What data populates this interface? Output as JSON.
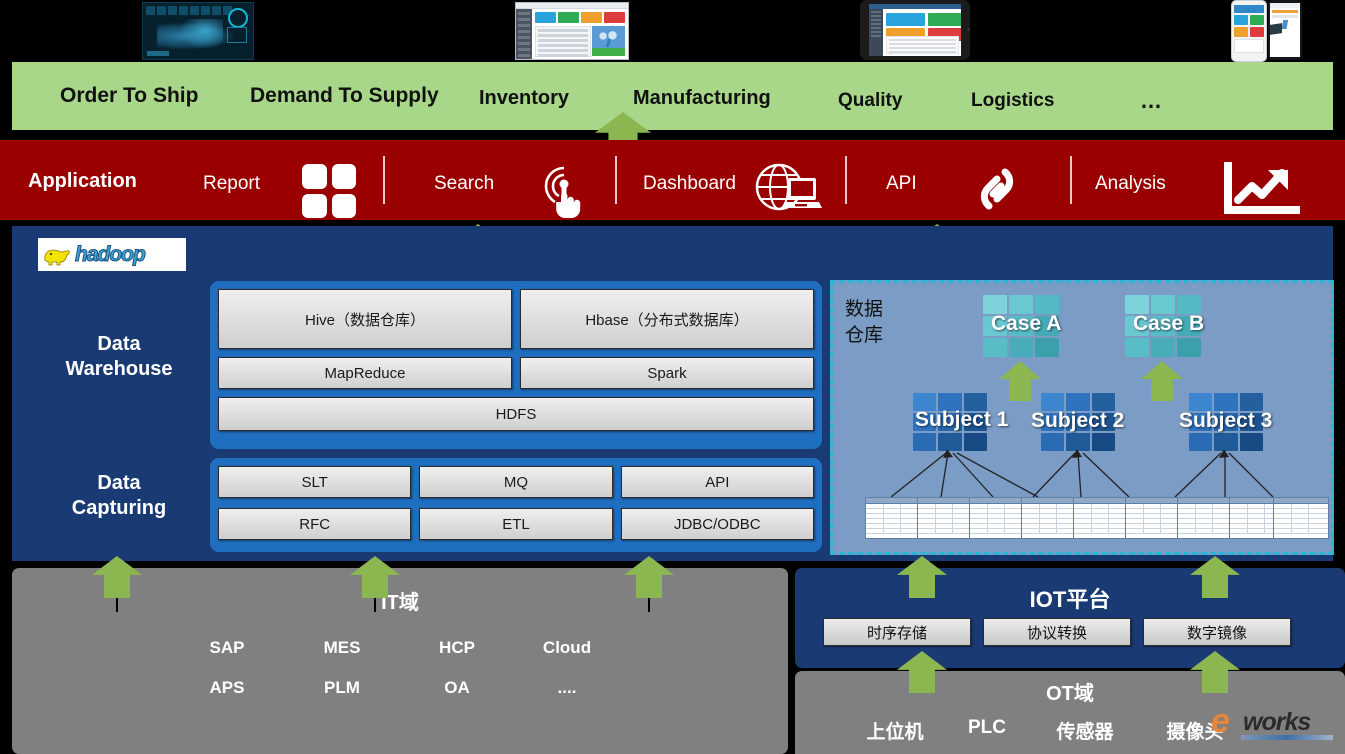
{
  "top_devices": [
    {
      "name": "dark-dashboard-screenshot"
    },
    {
      "name": "web-dashboard-screenshot"
    },
    {
      "name": "tablet-dashboard-screenshot"
    },
    {
      "name": "phone-dashboard-screenshot"
    },
    {
      "name": "phone-chart-screenshot"
    }
  ],
  "business_domains": {
    "items": [
      {
        "label": "Order To Ship"
      },
      {
        "label": "Demand To Supply"
      },
      {
        "label": "Inventory"
      },
      {
        "label": "Manufacturing"
      },
      {
        "label": "Quality"
      },
      {
        "label": "Logistics"
      },
      {
        "label": "…"
      }
    ],
    "color": "#a8d78a"
  },
  "application_layer": {
    "title": "Application",
    "color": "#9a0000",
    "items": [
      {
        "label": "Report",
        "icon": "grid-squares-icon"
      },
      {
        "label": "Search",
        "icon": "touch-tap-icon"
      },
      {
        "label": "Dashboard",
        "icon": "globe-laptop-icon"
      },
      {
        "label": "API",
        "icon": "chain-link-icon"
      },
      {
        "label": "Analysis",
        "icon": "trend-chart-icon"
      }
    ]
  },
  "platform": {
    "logo": "hadoop",
    "logo_text": "hadoop",
    "color": "#1a3a74",
    "warehouse": {
      "label_line1": "Data",
      "label_line2": "Warehouse",
      "row1": [
        {
          "label": "Hive（数据仓库）"
        },
        {
          "label": "Hbase（分布式数据库）"
        }
      ],
      "row2": [
        {
          "label": "MapReduce"
        },
        {
          "label": "Spark"
        }
      ],
      "row3": [
        {
          "label": "HDFS"
        }
      ]
    },
    "capturing": {
      "label_line1": "Data",
      "label_line2": "Capturing",
      "row1": [
        {
          "label": "SLT"
        },
        {
          "label": "MQ"
        },
        {
          "label": "API"
        }
      ],
      "row2": [
        {
          "label": "RFC"
        },
        {
          "label": "ETL"
        },
        {
          "label": "JDBC/ODBC"
        }
      ]
    }
  },
  "data_warehouse_panel": {
    "caption_line1": "数据",
    "caption_line2": "仓库",
    "background": "#7b9cc4",
    "border_color": "#2bb6d8",
    "cases": [
      {
        "label": "Case A",
        "color": "#5bc5cf"
      },
      {
        "label": "Case B",
        "color": "#5bc5cf"
      }
    ],
    "subjects": [
      {
        "label": "Subject 1",
        "color": "#1a5fa8"
      },
      {
        "label": "Subject 2",
        "color": "#1a5fa8"
      },
      {
        "label": "Subject 3",
        "color": "#1a5fa8"
      }
    ],
    "table_count": 9
  },
  "it_domain": {
    "title": "IT域",
    "color": "#808080",
    "row1": [
      {
        "label": "SAP"
      },
      {
        "label": "MES"
      },
      {
        "label": "HCP"
      },
      {
        "label": "Cloud"
      }
    ],
    "row2": [
      {
        "label": "APS"
      },
      {
        "label": "PLM"
      },
      {
        "label": "OA"
      },
      {
        "label": "...."
      }
    ]
  },
  "iot_platform": {
    "title": "IOT平台",
    "color": "#1a3a74",
    "buttons": [
      {
        "label": "时序存储"
      },
      {
        "label": "协议转换"
      },
      {
        "label": "数字镜像"
      }
    ]
  },
  "ot_domain": {
    "title": "OT域",
    "color": "#808080",
    "items": [
      {
        "label": "上位机"
      },
      {
        "label": "PLC"
      },
      {
        "label": "传感器"
      },
      {
        "label": "摄像头"
      }
    ]
  },
  "watermark": {
    "e": "e",
    "works": "works"
  },
  "arrow_color": "#8cb64f"
}
